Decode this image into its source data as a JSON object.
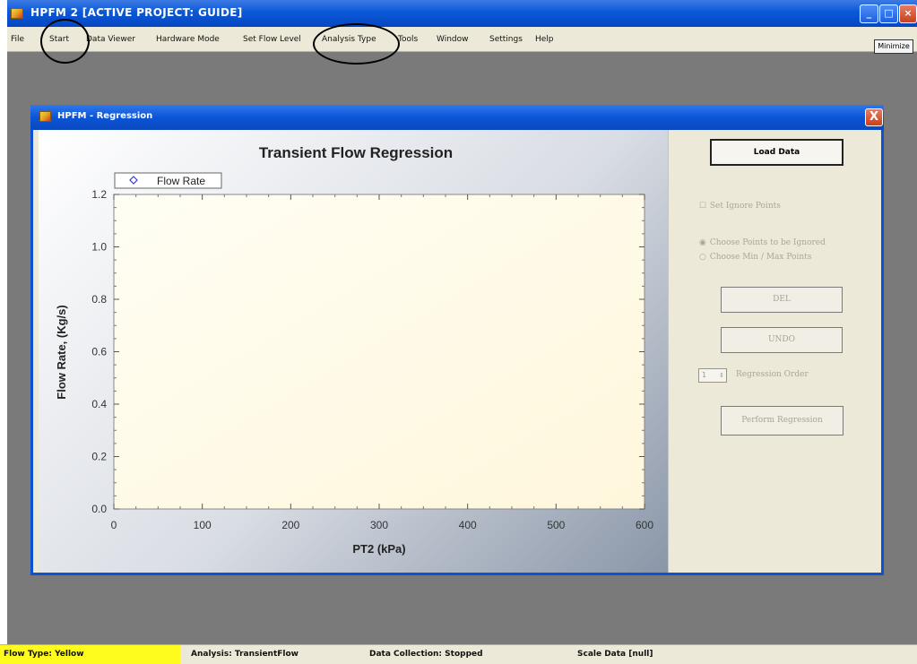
{
  "window": {
    "title": "HPFM 2 [ACTIVE PROJECT: GUIDE]",
    "minimize_label": "Minimize"
  },
  "menu": {
    "items": [
      "File",
      "Start",
      "Data Viewer",
      "Hardware Mode",
      "Set Flow Level",
      "Analysis Type",
      "Tools",
      "Window",
      "Settings",
      "Help"
    ]
  },
  "dialog": {
    "title": "HPFM - Regression",
    "close_label": "X"
  },
  "controls": {
    "load_data": "Load Data",
    "set_ignore_points": "Set Ignore Points",
    "choose_points_ignored": "Choose Points to be Ignored",
    "choose_min_max": "Choose Min / Max Points",
    "del": "DEL",
    "undo": "UNDO",
    "regression_order_label": "Regression Order",
    "regression_order_value": "1",
    "perform_regression": "Perform Regression"
  },
  "statusbar": {
    "flow_type": "Flow Type: Yellow",
    "analysis": "Analysis: TransientFlow",
    "data_collection": "Data Collection: Stopped",
    "scale_data": "Scale Data  [null]"
  },
  "colors": {
    "flow_type_bg": "#fdfc1e",
    "titlebar": "#0a58d8",
    "plot_area": "#fffbe8",
    "marker": "#3a3ad6"
  },
  "chart_data": {
    "type": "scatter",
    "title": "Transient Flow Regression",
    "xlabel": "PT2 (kPa)",
    "ylabel": "Flow Rate, (Kg/s)",
    "xlim": [
      0,
      600
    ],
    "ylim": [
      0.0,
      1.2
    ],
    "xticks": [
      "0",
      "100",
      "200",
      "300",
      "400",
      "500",
      "600"
    ],
    "yticks": [
      "0.0",
      "0.2",
      "0.4",
      "0.6",
      "0.8",
      "1.0",
      "1.2"
    ],
    "series": [
      {
        "name": "Flow Rate",
        "points": []
      }
    ],
    "legend_position": "top-left",
    "grid": false
  }
}
